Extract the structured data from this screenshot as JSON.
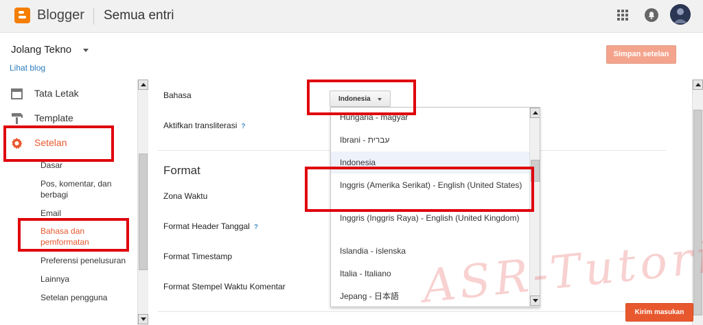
{
  "app": {
    "name": "Blogger",
    "page_title": "Semua entri",
    "brand_color": "#f57d00"
  },
  "header_icons": [
    "apps-grid-icon",
    "notifications-bell-icon",
    "avatar"
  ],
  "blog": {
    "name": "Jolang Tekno",
    "view_link": "Lihat blog",
    "save_button": "Simpan setelan"
  },
  "sidebar": {
    "items": [
      {
        "label": "Tata Letak",
        "icon": "layout-icon"
      },
      {
        "label": "Template",
        "icon": "paint-roller-icon"
      },
      {
        "label": "Setelan",
        "icon": "gear-icon",
        "active": true
      }
    ],
    "subitems": [
      {
        "label": "Dasar"
      },
      {
        "label": "Pos, komentar, dan berbagi"
      },
      {
        "label": "Email"
      },
      {
        "label": "Bahasa dan pemformatan",
        "active": true
      },
      {
        "label": "Preferensi penelusuran"
      },
      {
        "label": "Lainnya"
      },
      {
        "label": "Setelan pengguna"
      }
    ]
  },
  "settings": {
    "language_label": "Bahasa",
    "language_value": "Indonesia",
    "transliteration_label": "Aktifkan transliterasi",
    "help_glyph": "?",
    "format_title": "Format",
    "timezone_label": "Zona Waktu",
    "date_header_label": "Format Header Tanggal",
    "timestamp_label": "Format Timestamp",
    "comment_timestamp_label": "Format Stempel Waktu Komentar"
  },
  "language_options": [
    "Hungaria - magyar",
    "Ibrani - עברית",
    "Indonesia",
    "Inggris (Amerika Serikat) - English (United States)",
    "Inggris (Inggris Raya) - English (United Kingdom)",
    "Islandia - íslenska",
    "Italia - Italiano",
    "Jepang - 日本語"
  ],
  "selected_language": "Indonesia",
  "feedback_button": "Kirim masukan",
  "watermark": "ASR-Tutorial",
  "colors": {
    "accent": "#e8582f",
    "highlight": "#e0010b",
    "link": "#2a7bbd"
  }
}
